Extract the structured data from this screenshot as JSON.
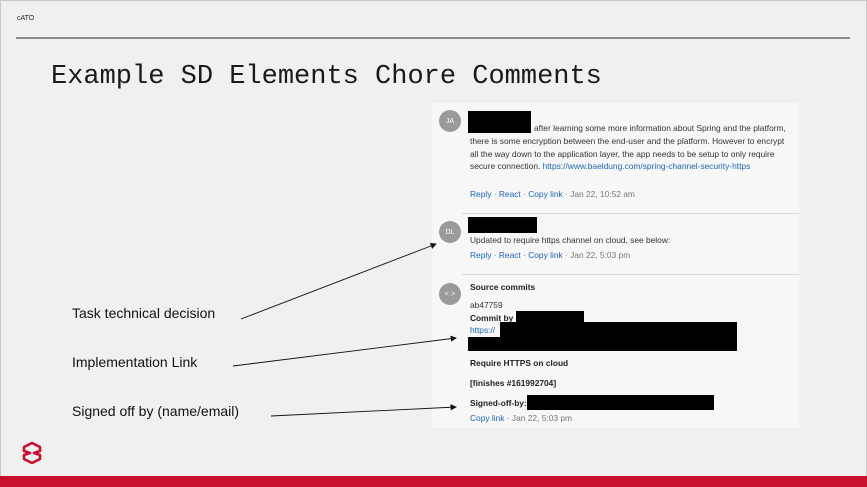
{
  "header": {
    "label": "cATO"
  },
  "title": "Example SD Elements Chore Comments",
  "comments": [
    {
      "avatar": "JA",
      "text": "after learning some more information about Spring and the platform, there is some encryption between the end-user and the platform. However to encrypt all the way down to the application layer, the app needs to be setup to only require secure connection.",
      "link": "https://www.baeldung.com/spring-channel-security-https",
      "actions": {
        "reply": "Reply",
        "react": "React",
        "copy": "Copy link",
        "time": "Jan 22, 10:52 am"
      }
    },
    {
      "avatar": "DL",
      "text": "Updated to require https channel on cloud, see below:",
      "actions": {
        "reply": "Reply",
        "react": "React",
        "copy": "Copy link",
        "time": "Jan 22, 5:03 pm"
      }
    },
    {
      "avatar": "<·>",
      "heading": "Source commits",
      "hash": "ab47759",
      "commit_by": "Commit by",
      "https": "https://",
      "message": "Require HTTPS on cloud",
      "finishes": "[finishes #161992704]",
      "signed_off": "Signed-off-by:",
      "actions": {
        "copy": "Copy link",
        "time": "Jan 22, 5:03 pm"
      }
    }
  ],
  "annotations": {
    "decision": "Task technical decision",
    "implementation": "Implementation Link",
    "signed": "Signed off by (name/email)"
  },
  "colors": {
    "brand_red": "#c8102e",
    "link_blue": "#1f66b0"
  }
}
